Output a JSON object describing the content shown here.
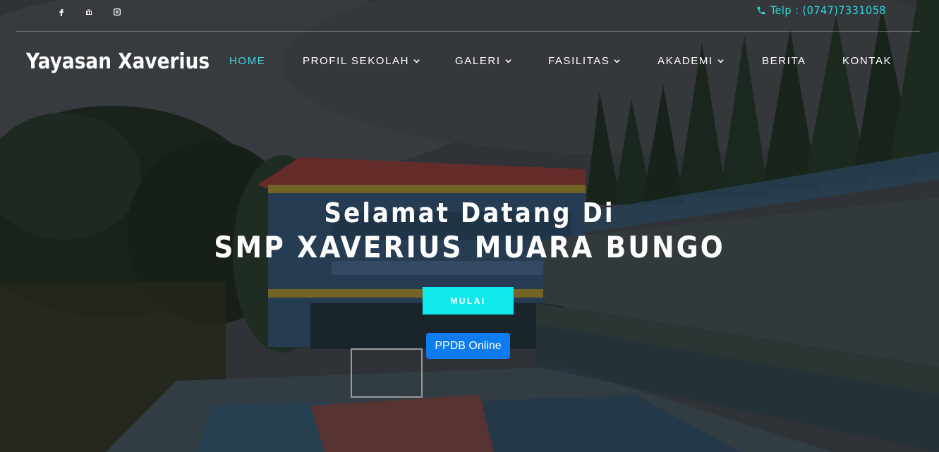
{
  "topbar": {
    "social": [
      {
        "name": "facebook-icon"
      },
      {
        "name": "youtube-icon"
      },
      {
        "name": "instagram-icon"
      }
    ],
    "phone_text": "Telp : (0747)7331058",
    "accent_color": "#2fd9e3"
  },
  "navbar": {
    "brand": "Yayasan Xaverius",
    "items": [
      {
        "label": "HOME",
        "active": true,
        "dropdown": false
      },
      {
        "label": "PROFIL SEKOLAH",
        "active": false,
        "dropdown": true
      },
      {
        "label": "GALERI",
        "active": false,
        "dropdown": true
      },
      {
        "label": "FASILITAS",
        "active": false,
        "dropdown": true
      },
      {
        "label": "AKADEMI",
        "active": false,
        "dropdown": true
      },
      {
        "label": "BERITA",
        "active": false,
        "dropdown": false
      },
      {
        "label": "KONTAK",
        "active": false,
        "dropdown": false
      }
    ]
  },
  "hero": {
    "line1": "Selamat Datang Di",
    "line2": "SMP XAVERIUS MUARA BUNGO",
    "start_button": "MULAI",
    "ppdb_button": "PPDB Online",
    "start_color": "#11e8ea",
    "ppdb_color": "#0d7cf0"
  }
}
